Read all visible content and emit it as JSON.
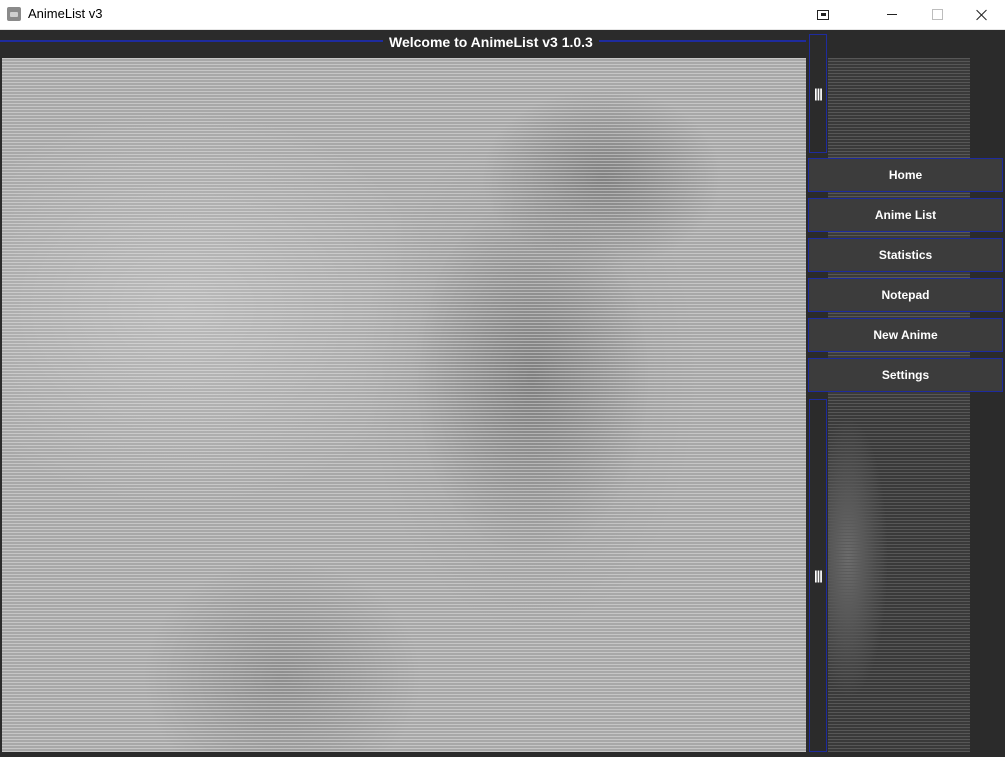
{
  "window": {
    "title": "AnimeList v3"
  },
  "header": {
    "title": "Welcome to AnimeList v3 1.0.3"
  },
  "splitter": {
    "top_grip": "|||",
    "bottom_grip": "|||"
  },
  "nav": {
    "items": [
      {
        "label": "Home"
      },
      {
        "label": "Anime List"
      },
      {
        "label": "Statistics"
      },
      {
        "label": "Notepad"
      },
      {
        "label": "New Anime"
      },
      {
        "label": "Settings"
      }
    ]
  },
  "colors": {
    "background": "#2b2b2b",
    "accent_border": "#1e2b9e",
    "button_bg": "#3c3c3c",
    "ascii_art": "#a8a8a8"
  }
}
